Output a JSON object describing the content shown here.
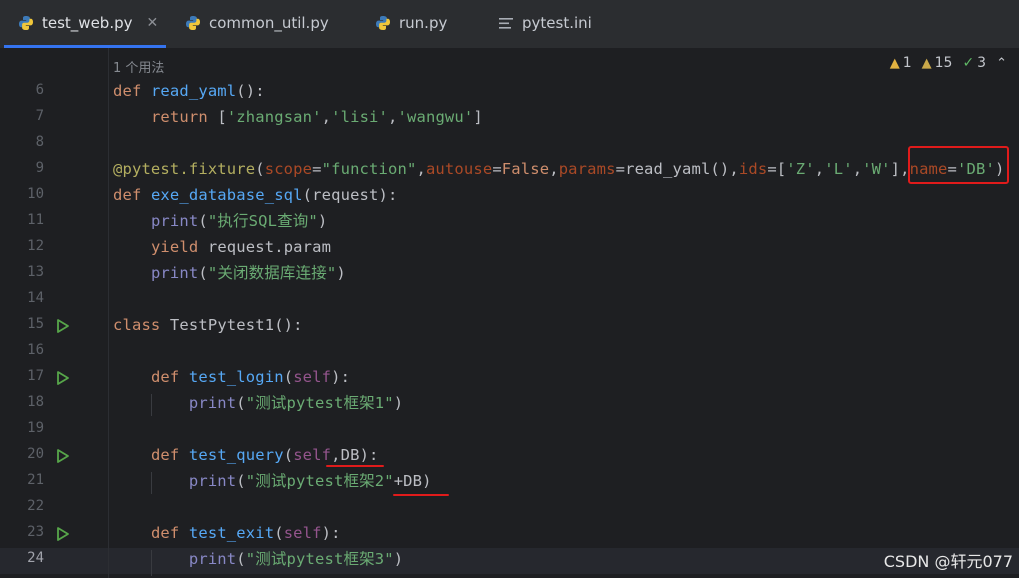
{
  "tabs": [
    {
      "label": "test_web.py",
      "active": true,
      "icon": "python-icon",
      "closable": true
    },
    {
      "label": "common_util.py",
      "active": false,
      "icon": "python-icon"
    },
    {
      "label": "run.py",
      "active": false,
      "icon": "python-icon"
    },
    {
      "label": "pytest.ini",
      "active": false,
      "icon": "ini-file-icon"
    }
  ],
  "editor": {
    "usage_hint": "1 个用法",
    "inspections": {
      "warnings": "1",
      "weak_warnings": "15",
      "ok": "3"
    },
    "lines": [
      {
        "n": "6",
        "text": "def read_yaml():"
      },
      {
        "n": "7",
        "text": "    return ['zhangsan','lisi','wangwu']"
      },
      {
        "n": "8",
        "text": ""
      },
      {
        "n": "9",
        "text": "@pytest.fixture(scope=\"function\",autouse=False,params=read_yaml(),ids=['Z','L','W'],name='DB')"
      },
      {
        "n": "10",
        "text": "def exe_database_sql(request):"
      },
      {
        "n": "11",
        "text": "    print(\"执行SQL查询\")"
      },
      {
        "n": "12",
        "text": "    yield request.param"
      },
      {
        "n": "13",
        "text": "    print(\"关闭数据库连接\")"
      },
      {
        "n": "14",
        "text": ""
      },
      {
        "n": "15",
        "text": "class TestPytest1():"
      },
      {
        "n": "16",
        "text": ""
      },
      {
        "n": "17",
        "text": "    def test_login(self):"
      },
      {
        "n": "18",
        "text": "        print(\"测试pytest框架1\")"
      },
      {
        "n": "19",
        "text": ""
      },
      {
        "n": "20",
        "text": "    def test_query(self,DB):"
      },
      {
        "n": "21",
        "text": "        print(\"测试pytest框架2\"+DB)"
      },
      {
        "n": "22",
        "text": ""
      },
      {
        "n": "23",
        "text": "    def test_exit(self):"
      },
      {
        "n": "24",
        "text": "        print(\"测试pytest框架3\")"
      }
    ]
  },
  "watermark": "CSDN @轩元077",
  "colors": {
    "accent": "#3574f0",
    "annotation": "#e01b1b",
    "background": "#1e1f22"
  }
}
